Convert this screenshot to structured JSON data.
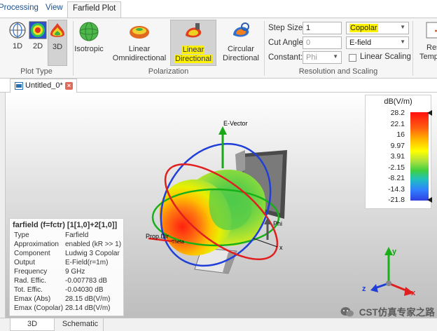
{
  "menu": {
    "tabs": [
      "Processing",
      "View",
      "Farfield Plot"
    ]
  },
  "ribbon": {
    "plot_type": {
      "label": "Plot Type",
      "buttons": [
        "1D",
        "2D",
        "3D"
      ]
    },
    "polarization": {
      "label": "Polarization",
      "buttons": [
        {
          "line1": "Isotropic",
          "line2": ""
        },
        {
          "line1": "Linear",
          "line2": "Omnidirectional"
        },
        {
          "line1": "Linear",
          "line2": "Directional"
        },
        {
          "line1": "Circular",
          "line2": "Directional"
        }
      ]
    },
    "resolution": {
      "label": "Resolution and Scaling",
      "step_size_label": "Step Size:",
      "step_size_value": "1",
      "cut_angle_label": "Cut Angle:",
      "cut_angle_value": "0",
      "constant_label": "Constant:",
      "constant_value": "Phi",
      "component_value": "Copolar",
      "field_value": "E-field",
      "linear_scaling_label": "Linear Scaling"
    },
    "reset": {
      "line1": "Res",
      "line2": "Temp"
    }
  },
  "document": {
    "tab_label": "Untitled_0*",
    "close": "×"
  },
  "viewport": {
    "e_vector_label": "E-Vector",
    "phi_label": "Phi",
    "prop_dir_label": "Prop.Dir",
    "theta_label": "Theta",
    "x_label": "x",
    "axes": {
      "x": "x",
      "y": "y",
      "z": "z"
    }
  },
  "legend": {
    "title": "dB(V/m)",
    "ticks": [
      "28.2",
      "22.1",
      "16",
      "9.97",
      "3.91",
      "-2.15",
      "-8.21",
      "-14.3",
      "-21.8"
    ]
  },
  "info": {
    "title": "farfield (f=fctr) [1[1,0]+2[1,0]]",
    "rows": [
      {
        "key": "Type",
        "value": "Farfield"
      },
      {
        "key": "Approximation",
        "value": "enabled (kR >> 1)"
      },
      {
        "key": "Component",
        "value": "Ludwig 3 Copolar"
      },
      {
        "key": "Output",
        "value": "E-Field(r=1m)"
      },
      {
        "key": "Frequency",
        "value": "9 GHz"
      },
      {
        "key": "Rad. Effic.",
        "value": "-0.007783 dB"
      },
      {
        "key": "Tot. Effic.",
        "value": "-0.04030 dB"
      },
      {
        "key": "Emax (Abs)",
        "value": "28.15 dB(V/m)"
      },
      {
        "key": "Emax (Copolar)",
        "value": "28.14 dB(V/m)"
      }
    ]
  },
  "bottom_tabs": [
    "3D",
    "Schematic"
  ],
  "watermark": "CST仿真专家之路",
  "colors": {
    "accent": "#1c4f8c",
    "highlight": "#fff200",
    "close": "#e06b5a"
  }
}
